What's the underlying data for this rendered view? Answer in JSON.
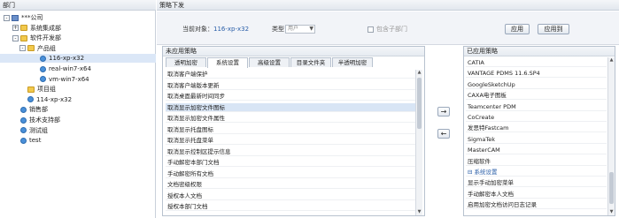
{
  "left": {
    "title": "部门",
    "tree": [
      {
        "label": "***公司",
        "icon": "company-icon",
        "toggle": "-",
        "level": 0
      },
      {
        "label": "系统集成部",
        "icon": "folder-icon",
        "toggle": "+",
        "level": 1
      },
      {
        "label": "软件开发部",
        "icon": "folder-icon",
        "toggle": "-",
        "level": 1
      },
      {
        "label": "产品组",
        "icon": "folder-icon",
        "toggle": "-",
        "level": 2
      },
      {
        "label": "116-xp-x32",
        "icon": "user-icon",
        "toggle": "",
        "level": 3,
        "selected": true
      },
      {
        "label": "real-win7-x64",
        "icon": "user-icon",
        "toggle": "",
        "level": 3
      },
      {
        "label": "vm-win7-x64",
        "icon": "user-icon",
        "toggle": "",
        "level": 3
      },
      {
        "label": "项目组",
        "icon": "folder-icon",
        "toggle": "",
        "level": 2
      },
      {
        "label": "114-xp-x32",
        "icon": "user-icon",
        "toggle": "",
        "level": 2
      },
      {
        "label": "销售部",
        "icon": "user-icon",
        "toggle": "",
        "level": 1
      },
      {
        "label": "技术支持部",
        "icon": "user-icon",
        "toggle": "",
        "level": 1
      },
      {
        "label": "测试组",
        "icon": "user-icon",
        "toggle": "",
        "level": 1
      },
      {
        "label": "test",
        "icon": "user-icon",
        "toggle": "",
        "level": 1
      }
    ]
  },
  "right": {
    "title": "策略下发",
    "current_label": "当前对象：",
    "current_value": "116-xp-x32",
    "type_label": "类型",
    "type_value": "用户",
    "include_sub_label": "包含子部门",
    "apply_btn": "应用",
    "apply_to_btn": "应用到",
    "unapplied_title": "未应用策略",
    "applied_title": "已应用策略",
    "tabs": [
      "透明加密",
      "系统设置",
      "高级设置",
      "目录文件夹",
      "半透明加密"
    ],
    "active_tab": 1,
    "unapplied_items": [
      "取消客户端保护",
      "取消客户端版本更新",
      "取消桌面最新时间同步",
      "取消显示加密文件图标",
      "取消显示加密文件属性",
      "取消显示托盘图标",
      "取消显示托盘菜单",
      "取消显示控制区提示信息",
      "手动解密本部门文档",
      "手动解密所有文档",
      "文档密级权限",
      "授权本人文档",
      "授权本部门文档"
    ],
    "unapplied_highlight": 3,
    "applied_items": [
      {
        "label": "CATIA",
        "group": false
      },
      {
        "label": "VANTAGE PDMS 11.6.SP4",
        "group": false
      },
      {
        "label": "GoogleSketchUp",
        "group": false
      },
      {
        "label": "CAXA电子图板",
        "group": false
      },
      {
        "label": "Teamcenter PDM",
        "group": false
      },
      {
        "label": "CoCreate",
        "group": false
      },
      {
        "label": "发思特Fastcam",
        "group": false
      },
      {
        "label": "SigmaTek",
        "group": false
      },
      {
        "label": "MasterCAM",
        "group": false
      },
      {
        "label": "压缩软件",
        "group": false
      },
      {
        "label": "系统设置",
        "group": true
      },
      {
        "label": "显示手动加密菜单",
        "group": false
      },
      {
        "label": "手动解密本人文档",
        "group": false
      },
      {
        "label": "启用加密文档访问日志记录",
        "group": false
      }
    ],
    "move_right": "→",
    "move_left": "←"
  }
}
